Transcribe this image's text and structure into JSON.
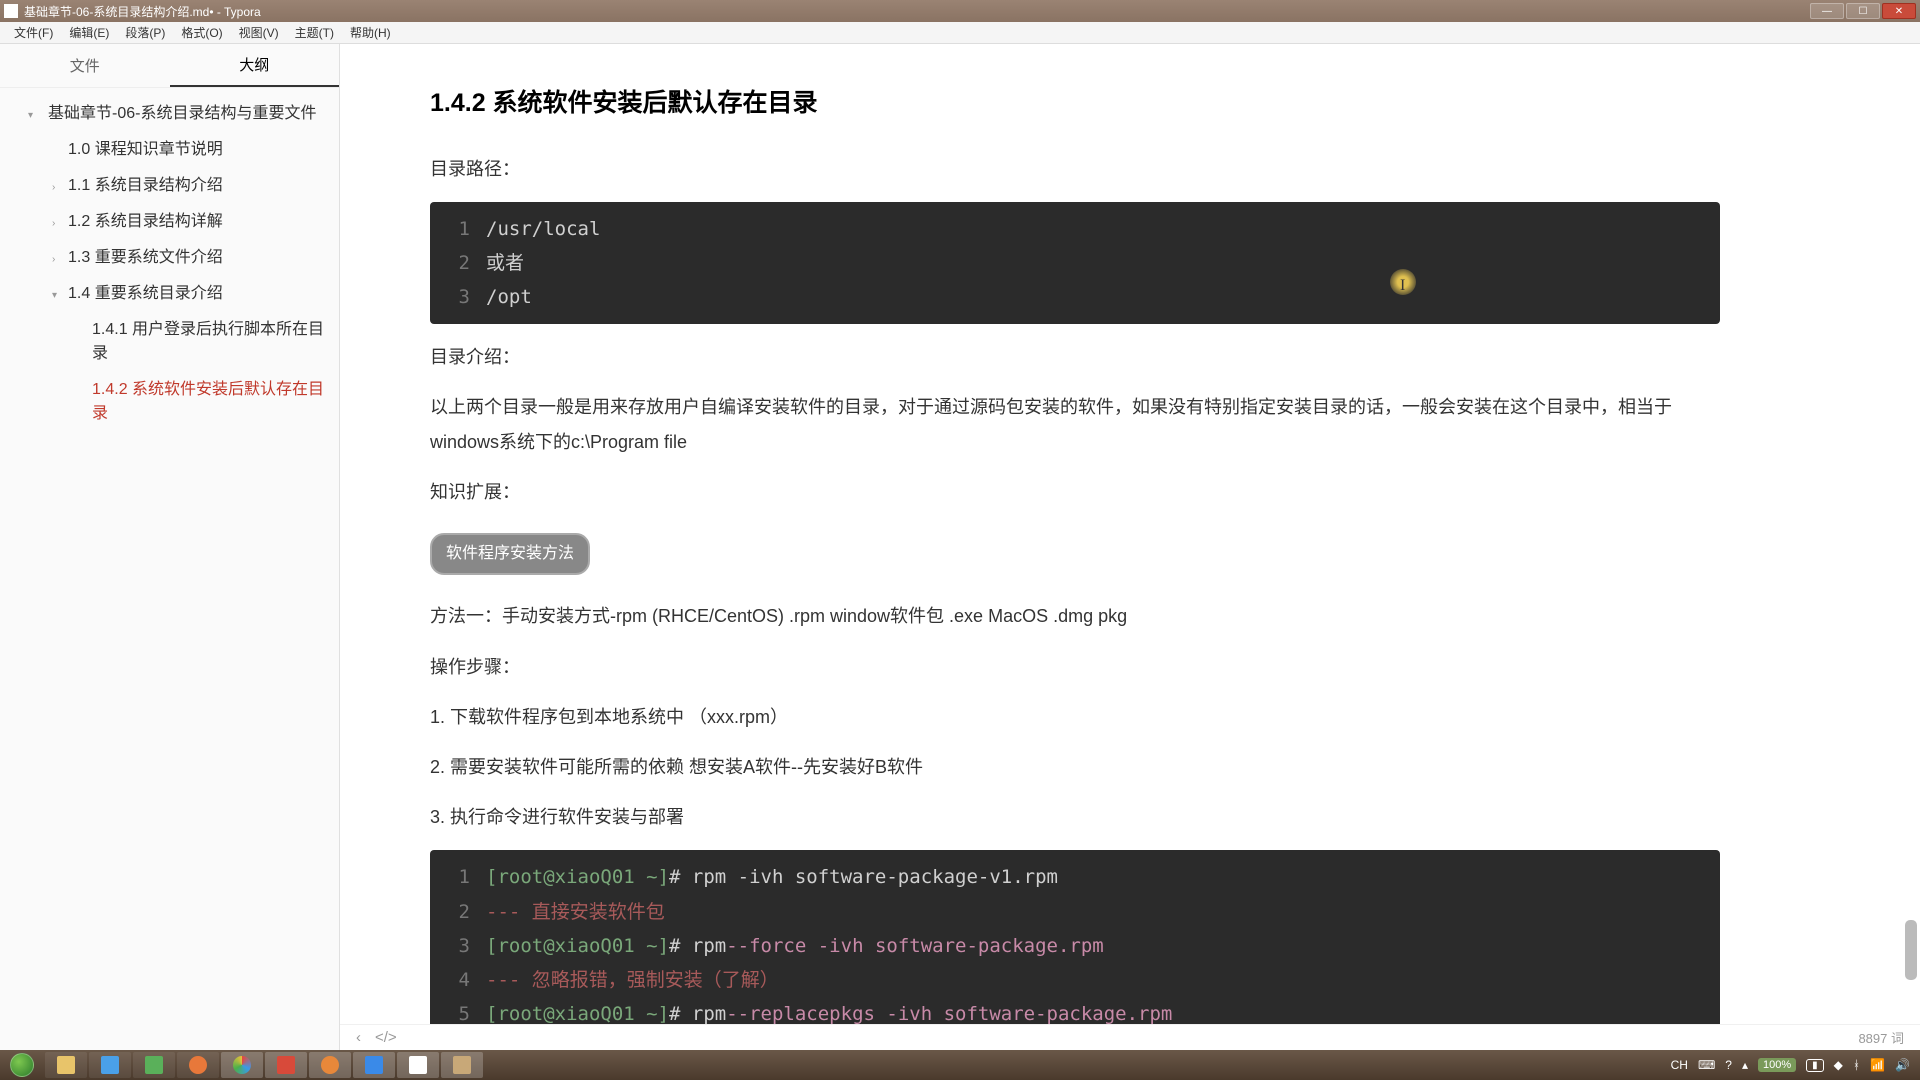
{
  "window": {
    "title": "基础章节-06-系统目录结构介绍.md• - Typora"
  },
  "menubar": [
    "文件(F)",
    "编辑(E)",
    "段落(P)",
    "格式(O)",
    "视图(V)",
    "主题(T)",
    "帮助(H)"
  ],
  "sidebar": {
    "tabs": {
      "files": "文件",
      "outline": "大纲"
    },
    "outline": [
      {
        "text": "基础章节-06-系统目录结构与重要文件",
        "cls": "root",
        "chev": "▾"
      },
      {
        "text": "1.0 课程知识章节说明",
        "cls": "level1"
      },
      {
        "text": "1.1 系统目录结构介绍",
        "cls": "level1",
        "chev": "›"
      },
      {
        "text": "1.2 系统目录结构详解",
        "cls": "level1",
        "chev": "›"
      },
      {
        "text": "1.3 重要系统文件介绍",
        "cls": "level1",
        "chev": "›"
      },
      {
        "text": "1.4 重要系统目录介绍",
        "cls": "level1",
        "chev": "▾"
      },
      {
        "text": "1.4.1 用户登录后执行脚本所在目录",
        "cls": "level2"
      },
      {
        "text": "1.4.2 系统软件安装后默认存在目录",
        "cls": "level2 active"
      }
    ]
  },
  "content": {
    "heading": "1.4.2 系统软件安装后默认存在目录",
    "p_path": "目录路径：",
    "code1": [
      "/usr/local",
      "或者",
      "/opt"
    ],
    "p_intro_label": "目录介绍：",
    "p_intro_body": "以上两个目录一般是用来存放用户自编译安装软件的目录，对于通过源码包安装的软件，如果没有特别指定安装目录的话，一般会安装在这个目录中，相当于windows系统下的c:\\Program file",
    "p_ext_label": "知识扩展：",
    "pill": "软件程序安装方法",
    "p_method1": "方法一：手动安装方式-rpm (RHCE/CentOS)  .rpm  window软件包  .exe  MacOS  .dmg  pkg",
    "p_steps_label": "操作步骤：",
    "steps": [
      "1. 下载软件程序包到本地系统中 （xxx.rpm）",
      "2. 需要安装软件可能所需的依赖   想安装A软件--先安装好B软件",
      "3. 执行命令进行软件安装与部署"
    ],
    "code2": [
      {
        "n": 1,
        "seg": [
          [
            "prompt",
            "[root@xiaoQ01 ~]"
          ],
          [
            "cmd",
            "# rpm -ivh software-package-v1.rpm"
          ]
        ]
      },
      {
        "n": 2,
        "seg": [
          [
            "comment",
            "--- 直接安装软件包"
          ]
        ]
      },
      {
        "n": 3,
        "seg": [
          [
            "prompt",
            "[root@xiaoQ01 ~]"
          ],
          [
            "cmd",
            "# rpm "
          ],
          [
            "opt",
            "--force -ivh software-package.rpm"
          ]
        ]
      },
      {
        "n": 4,
        "seg": [
          [
            "comment",
            "--- 忽略报错，强制安装（了解）"
          ]
        ]
      },
      {
        "n": 5,
        "seg": [
          [
            "prompt",
            "[root@xiaoQ01 ~]"
          ],
          [
            "cmd",
            "# rpm "
          ],
          [
            "opt",
            "--replacepkgs -ivh software-package.rpm"
          ]
        ]
      }
    ]
  },
  "status": {
    "wordcount": "8897 词"
  },
  "tray": {
    "ime": "CH",
    "zoom": "100%",
    "time": "",
    "battery": ""
  }
}
